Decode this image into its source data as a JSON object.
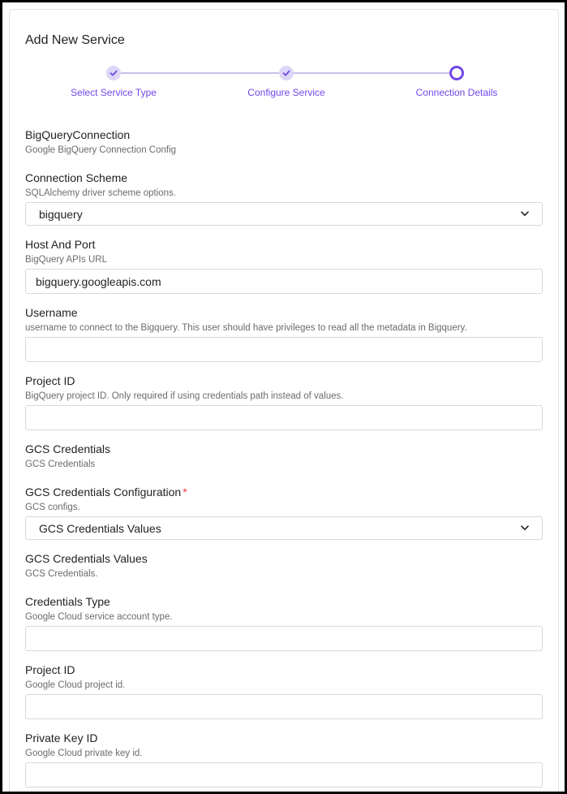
{
  "dialog": {
    "title": "Add New Service"
  },
  "stepper": {
    "steps": [
      {
        "label": "Select Service Type",
        "state": "completed"
      },
      {
        "label": "Configure Service",
        "state": "completed"
      },
      {
        "label": "Connection Details",
        "state": "active"
      }
    ],
    "accent_color": "#7147e8"
  },
  "form": {
    "section": {
      "title": "BigQueryConnection",
      "description": "Google BigQuery Connection Config"
    },
    "connection_scheme": {
      "label": "Connection Scheme",
      "description": "SQLAlchemy driver scheme options.",
      "selected": "bigquery"
    },
    "host_and_port": {
      "label": "Host And Port",
      "description": "BigQuery APIs URL",
      "value": "bigquery.googleapis.com"
    },
    "username": {
      "label": "Username",
      "description": "username to connect to the Bigquery. This user should have privileges to read all the metadata in Bigquery.",
      "value": ""
    },
    "project_id": {
      "label": "Project ID",
      "description": "BigQuery project ID. Only required if using credentials path instead of values.",
      "value": ""
    },
    "gcs_credentials": {
      "title": "GCS Credentials",
      "description": "GCS Credentials"
    },
    "gcs_credentials_configuration": {
      "label": "GCS Credentials Configuration",
      "required_marker": "*",
      "description": "GCS configs.",
      "selected": "GCS Credentials Values"
    },
    "gcs_credentials_values": {
      "title": "GCS Credentials Values",
      "description": "GCS Credentials."
    },
    "credentials_type": {
      "label": "Credentials Type",
      "description": "Google Cloud service account type.",
      "value": ""
    },
    "gcp_project_id": {
      "label": "Project ID",
      "description": "Google Cloud project id.",
      "value": ""
    },
    "private_key_id": {
      "label": "Private Key ID",
      "description": "Google Cloud private key id.",
      "value": ""
    }
  }
}
